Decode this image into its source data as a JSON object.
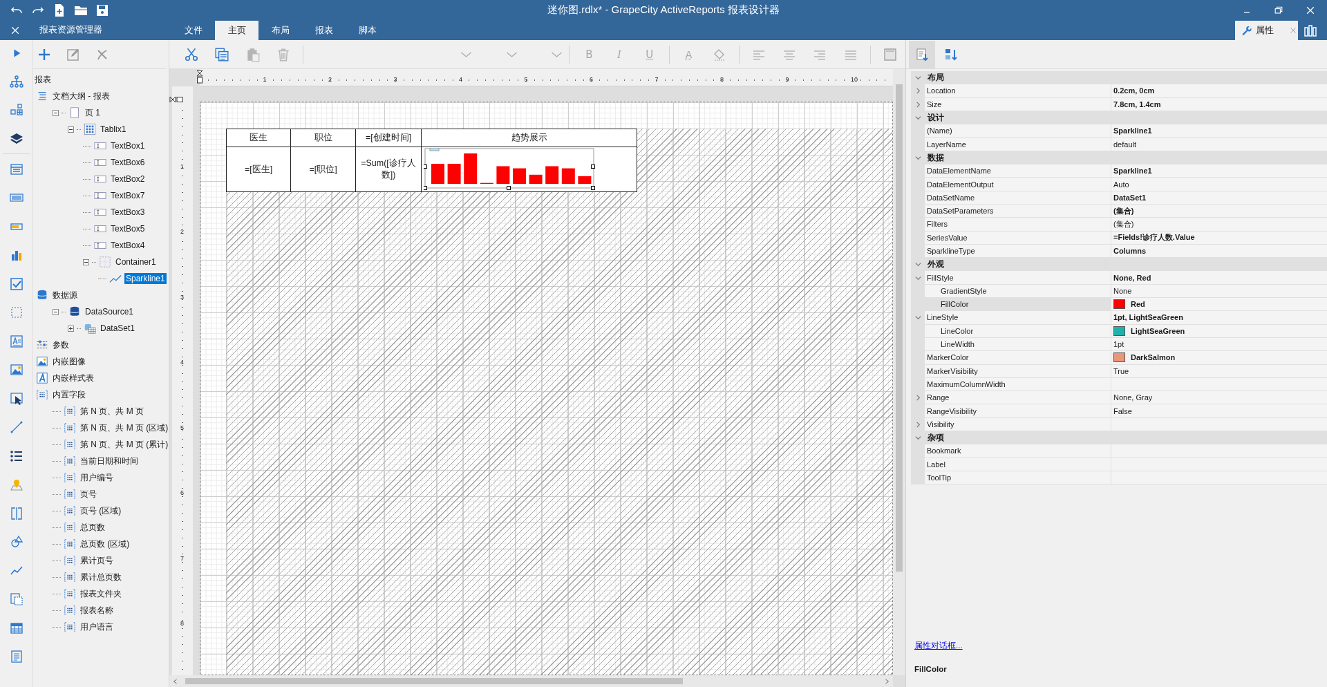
{
  "window": {
    "title": "迷你图.rdlx* - GrapeCity ActiveReports 报表设计器"
  },
  "explorer_tab": {
    "label": "报表资源管理器"
  },
  "ribbon_tabs": [
    {
      "label": "文件",
      "selected": false
    },
    {
      "label": "主页",
      "selected": true
    },
    {
      "label": "布局",
      "selected": false
    },
    {
      "label": "报表",
      "selected": false
    },
    {
      "label": "脚本",
      "selected": false
    }
  ],
  "properties_tab": {
    "label": "属性"
  },
  "edit_tools": [
    {
      "kind": "cut",
      "disabled": false
    },
    {
      "kind": "copy",
      "disabled": false
    },
    {
      "kind": "paste",
      "disabled": true
    },
    {
      "kind": "delete",
      "disabled": true
    }
  ],
  "format_buttons": [
    {
      "label": "B",
      "kind": "bold",
      "disabled": true
    },
    {
      "label": "I",
      "kind": "italic",
      "disabled": true
    },
    {
      "label": "U",
      "kind": "underline",
      "disabled": true
    },
    {
      "label": "A",
      "kind": "font-color",
      "disabled": true
    }
  ],
  "tree": {
    "root": "报表",
    "items": [
      {
        "label": "文档大纲 - 报表",
        "kind": "outline",
        "selected": false,
        "children": [
          {
            "label": "页 1",
            "kind": "page",
            "selected": false,
            "expanded": true,
            "children": [
              {
                "label": "Tablix1",
                "kind": "tablix",
                "selected": false,
                "expanded": true,
                "children": [
                  {
                    "label": "TextBox1",
                    "kind": "textbox",
                    "selected": false
                  },
                  {
                    "label": "TextBox6",
                    "kind": "textbox",
                    "selected": false
                  },
                  {
                    "label": "TextBox2",
                    "kind": "textbox",
                    "selected": false
                  },
                  {
                    "label": "TextBox7",
                    "kind": "textbox",
                    "selected": false
                  },
                  {
                    "label": "TextBox3",
                    "kind": "textbox",
                    "selected": false
                  },
                  {
                    "label": "TextBox5",
                    "kind": "textbox",
                    "selected": false
                  },
                  {
                    "label": "TextBox4",
                    "kind": "textbox",
                    "selected": false
                  },
                  {
                    "label": "Container1",
                    "kind": "container",
                    "selected": false,
                    "expanded": true,
                    "children": [
                      {
                        "label": "Sparkline1",
                        "kind": "sparkline",
                        "selected": true
                      }
                    ]
                  }
                ]
              }
            ]
          }
        ]
      },
      {
        "label": "数据源",
        "kind": "datasources",
        "selected": false,
        "children": [
          {
            "label": "DataSource1",
            "kind": "database",
            "selected": false,
            "expanded": true,
            "children": [
              {
                "label": "DataSet1",
                "kind": "dataset",
                "selected": false,
                "expanded": false
              }
            ]
          }
        ]
      },
      {
        "label": "参数",
        "kind": "params",
        "selected": false
      },
      {
        "label": "内嵌图像",
        "kind": "images",
        "selected": false
      },
      {
        "label": "内嵌样式表",
        "kind": "styles",
        "selected": false
      },
      {
        "label": "内置字段",
        "kind": "fields",
        "selected": false,
        "children": [
          {
            "label": "第 N 页、共 M 页",
            "kind": "field",
            "selected": false
          },
          {
            "label": "第 N 页、共 M 页 (区域)",
            "kind": "field",
            "selected": false
          },
          {
            "label": "第 N 页、共 M 页 (累计)",
            "kind": "field",
            "selected": false
          },
          {
            "label": "当前日期和时间",
            "kind": "field",
            "selected": false
          },
          {
            "label": "用户编号",
            "kind": "field",
            "selected": false
          },
          {
            "label": "页号",
            "kind": "field",
            "selected": false
          },
          {
            "label": "页号 (区域)",
            "kind": "field",
            "selected": false
          },
          {
            "label": "总页数",
            "kind": "field",
            "selected": false
          },
          {
            "label": "总页数 (区域)",
            "kind": "field",
            "selected": false
          },
          {
            "label": "累计页号",
            "kind": "field",
            "selected": false
          },
          {
            "label": "累计总页数",
            "kind": "field",
            "selected": false
          },
          {
            "label": "报表文件夹",
            "kind": "field",
            "selected": false
          },
          {
            "label": "报表名称",
            "kind": "field",
            "selected": false
          },
          {
            "label": "用户语言",
            "kind": "field",
            "selected": false
          }
        ]
      }
    ]
  },
  "ruler": {
    "horizontal": [
      "1",
      "2",
      "3",
      "4",
      "5",
      "6",
      "7",
      "8",
      "9",
      "10"
    ],
    "vertical": [
      "1",
      "2",
      "3",
      "4",
      "5",
      "6",
      "7",
      "8"
    ]
  },
  "report_table": {
    "header": [
      "医生",
      "职位",
      "=[创建时间]",
      "趋势展示"
    ],
    "row": [
      "=[医生]",
      "=[职位]",
      "=Sum([诊疗人数])"
    ]
  },
  "properties": [
    {
      "category": "布局",
      "expanded": true,
      "rows": [
        {
          "name": "Location",
          "value": "0.2cm, 0cm",
          "modified": true,
          "expanded": false,
          "selected": false
        },
        {
          "name": "Size",
          "value": "7.8cm, 1.4cm",
          "modified": true,
          "expanded": false,
          "selected": false
        }
      ]
    },
    {
      "category": "设计",
      "expanded": true,
      "rows": [
        {
          "name": "(Name)",
          "value": "Sparkline1",
          "modified": true,
          "selected": false
        },
        {
          "name": "LayerName",
          "value": "default",
          "modified": false,
          "selected": false
        }
      ]
    },
    {
      "category": "数据",
      "expanded": true,
      "rows": [
        {
          "name": "DataElementName",
          "value": "Sparkline1",
          "modified": true,
          "selected": false
        },
        {
          "name": "DataElementOutput",
          "value": "Auto",
          "modified": false,
          "selected": false
        },
        {
          "name": "DataSetName",
          "value": "DataSet1",
          "modified": true,
          "selected": false
        },
        {
          "name": "DataSetParameters",
          "value": "(集合)",
          "modified": true,
          "selected": false
        },
        {
          "name": "Filters",
          "value": "(集合)",
          "modified": false,
          "selected": false
        },
        {
          "name": "SeriesValue",
          "value": "=Fields!诊疗人数.Value",
          "modified": true,
          "selected": false
        },
        {
          "name": "SparklineType",
          "value": "Columns",
          "modified": true,
          "selected": false
        }
      ]
    },
    {
      "category": "外观",
      "expanded": true,
      "rows": [
        {
          "name": "FillStyle",
          "value": "None, Red",
          "modified": true,
          "expanded": true,
          "selected": false,
          "children": [
            {
              "name": "GradientStyle",
              "value": "None",
              "modified": false,
              "selected": false
            },
            {
              "name": "FillColor",
              "value": "Red",
              "modified": true,
              "color": "#ff0000",
              "selected": true
            }
          ]
        },
        {
          "name": "LineStyle",
          "value": "1pt, LightSeaGreen",
          "modified": true,
          "expanded": true,
          "selected": false,
          "children": [
            {
              "name": "LineColor",
              "value": "LightSeaGreen",
              "modified": true,
              "color": "#20b2aa",
              "selected": false
            },
            {
              "name": "LineWidth",
              "value": "1pt",
              "modified": false,
              "selected": false
            }
          ]
        },
        {
          "name": "MarkerColor",
          "value": "DarkSalmon",
          "modified": true,
          "color": "#e9967a",
          "selected": false
        },
        {
          "name": "MarkerVisibility",
          "value": "True",
          "modified": false,
          "selected": false
        },
        {
          "name": "MaximumColumnWidth",
          "selected": false
        },
        {
          "name": "Range",
          "value": "None, Gray",
          "modified": false,
          "expanded": false,
          "selected": false
        },
        {
          "name": "RangeVisibility",
          "value": "False",
          "modified": false,
          "selected": false
        },
        {
          "name": "Visibility",
          "expanded": false,
          "selected": false
        }
      ]
    },
    {
      "category": "杂项",
      "expanded": true,
      "rows": [
        {
          "name": "Bookmark",
          "selected": false
        },
        {
          "name": "Label",
          "selected": false
        },
        {
          "name": "ToolTip",
          "selected": false
        }
      ]
    }
  ],
  "property_dialog_link": "属性对话框...",
  "description": {
    "title": "FillColor"
  }
}
